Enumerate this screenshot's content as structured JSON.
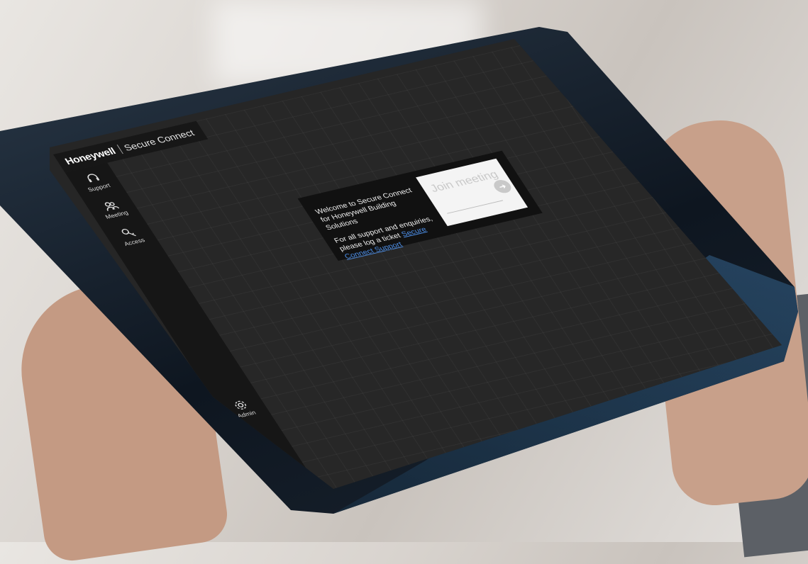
{
  "app": {
    "brand": "Honeywell",
    "product": "Secure Connect"
  },
  "sidebar": {
    "items": [
      {
        "label": "Support",
        "icon": "headset-icon"
      },
      {
        "label": "Meeting",
        "icon": "people-icon"
      },
      {
        "label": "Access",
        "icon": "key-icon"
      },
      {
        "label": "Admin",
        "icon": "gear-icon"
      }
    ]
  },
  "welcome": {
    "line1": "Welcome to Secure Connect for Honeywell Building Solutions",
    "line2_prefix": "For all support and enquiries, please log a ticket ",
    "link_label": "Secure Connect Support",
    "join_placeholder": "Join meeting",
    "go_icon": "arrow-right-icon"
  },
  "colors": {
    "screen_bg": "#272727",
    "sidebar_bg": "#161616",
    "link": "#4d8fe8"
  }
}
